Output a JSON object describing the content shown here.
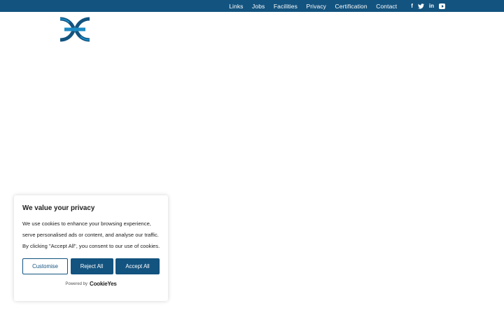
{
  "colors": {
    "primary": "#13537f",
    "background": "#ffffff",
    "text": "#212121"
  },
  "topbar": {
    "nav": [
      "Links",
      "Jobs",
      "Facilities",
      "Privacy",
      "Certification",
      "Contact"
    ],
    "social": {
      "facebook": "f",
      "twitter": "twitter-icon",
      "linkedin": "in",
      "youtube": "youtube-icon"
    }
  },
  "logo": {
    "icon": "company-logo"
  },
  "cookie_banner": {
    "title": "We value your privacy",
    "body": "We use cookies to enhance your browsing experience, serve personalised ads or content, and analyse our traffic. By clicking \"Accept All\", you consent to our use of cookies.",
    "customise_label": "Customise",
    "reject_label": "Reject All",
    "accept_label": "Accept All",
    "powered_by": "Powered by",
    "brand": "CookieYes"
  }
}
